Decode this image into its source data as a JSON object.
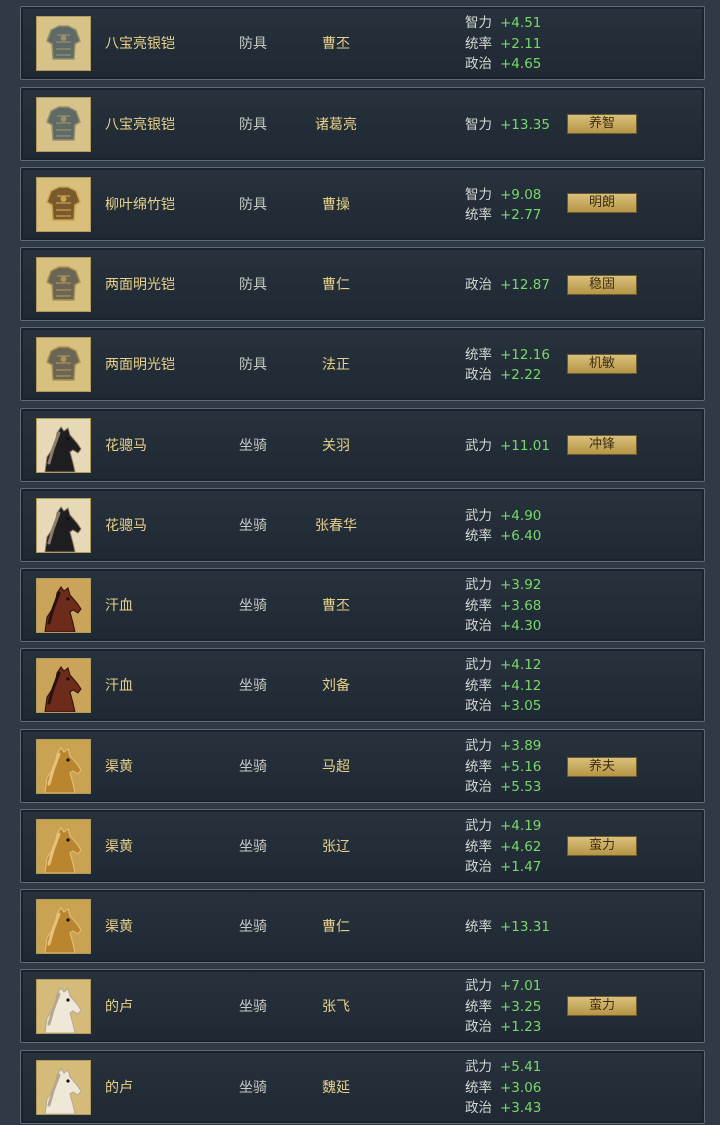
{
  "rows": [
    {
      "name": "八宝亮银铠",
      "type": "防具",
      "owner": "曹丕",
      "icon": "armor-silver-icon",
      "stats": [
        {
          "label": "智力",
          "value": "+4.51"
        },
        {
          "label": "统率",
          "value": "+2.11"
        },
        {
          "label": "政治",
          "value": "+4.65"
        }
      ],
      "tag": ""
    },
    {
      "name": "八宝亮银铠",
      "type": "防具",
      "owner": "诸葛亮",
      "icon": "armor-silver-icon",
      "stats": [
        {
          "label": "智力",
          "value": "+13.35"
        }
      ],
      "tag": "养智"
    },
    {
      "name": "柳叶绵竹铠",
      "type": "防具",
      "owner": "曹操",
      "icon": "armor-gold-icon",
      "stats": [
        {
          "label": "智力",
          "value": "+9.08"
        },
        {
          "label": "统率",
          "value": "+2.77"
        }
      ],
      "tag": "明朗"
    },
    {
      "name": "两面明光铠",
      "type": "防具",
      "owner": "曹仁",
      "icon": "armor-bronze-icon",
      "stats": [
        {
          "label": "政治",
          "value": "+12.87"
        }
      ],
      "tag": "稳固"
    },
    {
      "name": "两面明光铠",
      "type": "防具",
      "owner": "法正",
      "icon": "armor-bronze-icon",
      "stats": [
        {
          "label": "统率",
          "value": "+12.16"
        },
        {
          "label": "政治",
          "value": "+2.22"
        }
      ],
      "tag": "机敏"
    },
    {
      "name": "花骢马",
      "type": "坐骑",
      "owner": "关羽",
      "icon": "horse-black-icon",
      "stats": [
        {
          "label": "武力",
          "value": "+11.01"
        }
      ],
      "tag": "冲锋"
    },
    {
      "name": "花骢马",
      "type": "坐骑",
      "owner": "张春华",
      "icon": "horse-black-icon",
      "stats": [
        {
          "label": "武力",
          "value": "+4.90"
        },
        {
          "label": "统率",
          "value": "+6.40"
        }
      ],
      "tag": ""
    },
    {
      "name": "汗血",
      "type": "坐骑",
      "owner": "曹丕",
      "icon": "horse-red-icon",
      "stats": [
        {
          "label": "武力",
          "value": "+3.92"
        },
        {
          "label": "统率",
          "value": "+3.68"
        },
        {
          "label": "政治",
          "value": "+4.30"
        }
      ],
      "tag": ""
    },
    {
      "name": "汗血",
      "type": "坐骑",
      "owner": "刘备",
      "icon": "horse-red-icon",
      "stats": [
        {
          "label": "武力",
          "value": "+4.12"
        },
        {
          "label": "统率",
          "value": "+4.12"
        },
        {
          "label": "政治",
          "value": "+3.05"
        }
      ],
      "tag": ""
    },
    {
      "name": "渠黄",
      "type": "坐骑",
      "owner": "马超",
      "icon": "horse-gold-icon",
      "stats": [
        {
          "label": "武力",
          "value": "+3.89"
        },
        {
          "label": "统率",
          "value": "+5.16"
        },
        {
          "label": "政治",
          "value": "+5.53"
        }
      ],
      "tag": "养夫"
    },
    {
      "name": "渠黄",
      "type": "坐骑",
      "owner": "张辽",
      "icon": "horse-gold-icon",
      "stats": [
        {
          "label": "武力",
          "value": "+4.19"
        },
        {
          "label": "统率",
          "value": "+4.62"
        },
        {
          "label": "政治",
          "value": "+1.47"
        }
      ],
      "tag": "蛮力"
    },
    {
      "name": "渠黄",
      "type": "坐骑",
      "owner": "曹仁",
      "icon": "horse-gold-icon",
      "stats": [
        {
          "label": "统率",
          "value": "+13.31"
        }
      ],
      "tag": ""
    },
    {
      "name": "的卢",
      "type": "坐骑",
      "owner": "张飞",
      "icon": "horse-white-icon",
      "stats": [
        {
          "label": "武力",
          "value": "+7.01"
        },
        {
          "label": "统率",
          "value": "+3.25"
        },
        {
          "label": "政治",
          "value": "+1.23"
        }
      ],
      "tag": "蛮力"
    },
    {
      "name": "的卢",
      "type": "坐骑",
      "owner": "魏延",
      "icon": "horse-white-icon",
      "stats": [
        {
          "label": "武力",
          "value": "+5.41"
        },
        {
          "label": "统率",
          "value": "+3.06"
        },
        {
          "label": "政治",
          "value": "+3.43"
        }
      ],
      "tag": ""
    }
  ]
}
